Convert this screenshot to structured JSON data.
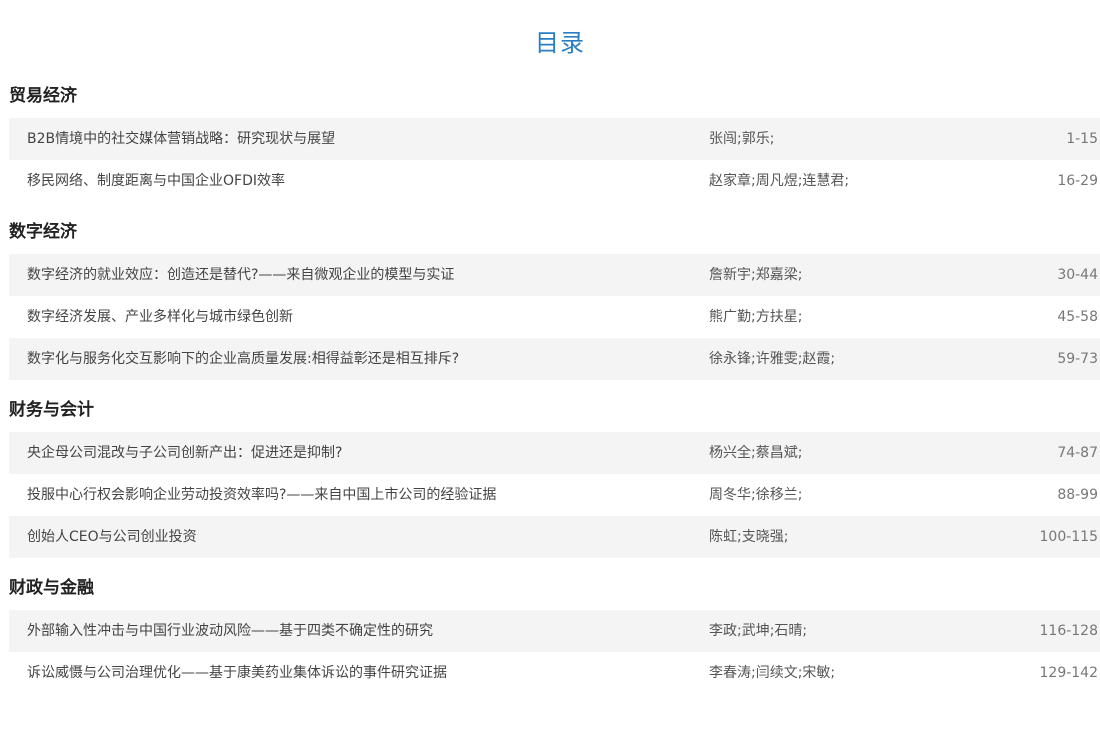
{
  "toc": {
    "title": "目录"
  },
  "sections": [
    {
      "heading": "贸易经济",
      "articles": [
        {
          "title": "B2B情境中的社交媒体营销战略：研究现状与展望",
          "authors": "张闯;郭乐;",
          "pages": "1-15"
        },
        {
          "title": "移民网络、制度距离与中国企业OFDI效率",
          "authors": "赵家章;周凡煜;连慧君;",
          "pages": "16-29"
        }
      ]
    },
    {
      "heading": "数字经济",
      "articles": [
        {
          "title": "数字经济的就业效应：创造还是替代?——来自微观企业的模型与实证",
          "authors": "詹新宇;郑嘉梁;",
          "pages": "30-44"
        },
        {
          "title": "数字经济发展、产业多样化与城市绿色创新",
          "authors": "熊广勤;方扶星;",
          "pages": "45-58"
        },
        {
          "title": "数字化与服务化交互影响下的企业高质量发展:相得益彰还是相互排斥?",
          "authors": "徐永锋;许雅雯;赵霞;",
          "pages": "59-73"
        }
      ]
    },
    {
      "heading": "财务与会计",
      "articles": [
        {
          "title": "央企母公司混改与子公司创新产出：促进还是抑制?",
          "authors": "杨兴全;蔡昌斌;",
          "pages": "74-87"
        },
        {
          "title": "投服中心行权会影响企业劳动投资效率吗?——来自中国上市公司的经验证据",
          "authors": "周冬华;徐移兰;",
          "pages": "88-99"
        },
        {
          "title": "创始人CEO与公司创业投资",
          "authors": "陈虹;支晓强;",
          "pages": "100-115"
        }
      ]
    },
    {
      "heading": "财政与金融",
      "articles": [
        {
          "title": "外部输入性冲击与中国行业波动风险——基于四类不确定性的研究",
          "authors": "李政;武坤;石晴;",
          "pages": "116-128"
        },
        {
          "title": "诉讼威慑与公司治理优化——基于康美药业集体诉讼的事件研究证据",
          "authors": "李春涛;闫续文;宋敏;",
          "pages": "129-142"
        }
      ]
    }
  ]
}
